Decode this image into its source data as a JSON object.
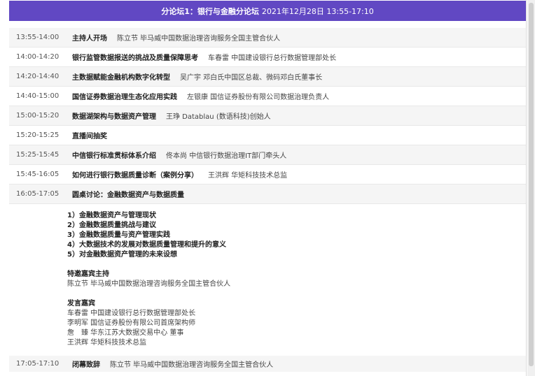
{
  "header": {
    "title": "分论坛1：银行与金融分论坛",
    "datetime": "2021年12月28日 13:55-17:10"
  },
  "schedule": [
    {
      "time": "13:55-14:00",
      "topic": "主持人开场",
      "speaker": "陈立节 毕马威中国数据治理咨询服务全国主管合伙人"
    },
    {
      "time": "14:00-14:20",
      "topic": "银行监管数据报送的挑战及质量保障思考",
      "speaker": "车春雷 中国建设银行总行数据管理部处长"
    },
    {
      "time": "14:20-14:40",
      "topic": "主数据赋能金融机构数字化转型",
      "speaker": "吴广宇 邓白氏中国区总裁、微码邓白氏董事长"
    },
    {
      "time": "14:40-15:00",
      "topic": "国信证券数据治理生态化应用实践",
      "speaker": "左银康 国信证券股份有限公司数据治理负责人"
    },
    {
      "time": "15:00-15:20",
      "topic": "数据湖架构与数据资产管理",
      "speaker": "王琤 Datablau (数语科技)创始人"
    },
    {
      "time": "15:20-15:25",
      "topic": "直播间抽奖",
      "speaker": ""
    },
    {
      "time": "15:25-15:45",
      "topic": "中信银行标准贯标体系介绍",
      "speaker": "佟本尚 中信银行数据治理IT部门牵头人"
    },
    {
      "time": "15:45-16:05",
      "topic": "如何进行银行数据质量诊断（案例分享）",
      "speaker": "王洪辉 华矩科技技术总监"
    },
    {
      "time": "16:05-17:05",
      "topic": "圆桌讨论：金融数据资产与数据质量",
      "speaker": ""
    }
  ],
  "panel": {
    "points": [
      "1）金融数据资产与管理现状",
      "2）金融数据质量挑战与建议",
      "3）金融数据质量与资产管理实践",
      "4）大数据技术的发展对数据质量管理和提升的意义",
      "5）对金融数据资产管理的未来设想"
    ],
    "host_title": "特邀嘉宾主持",
    "host": "陈立节 毕马威中国数据治理咨询服务全国主管合伙人",
    "guests_title": "发言嘉宾",
    "guests": [
      "车春雷 中国建设银行总行数据管理部处长",
      "李明军 国信证券股份有限公司首席架构师",
      "詹　臻 华东江苏大数据交易中心 董事",
      "王洪辉 华矩科技技术总监"
    ]
  },
  "closing": {
    "time": "17:05-17:10",
    "topic": "闭幕致辞",
    "speaker": "陈立节 毕马威中国数据治理咨询服务全国主管合伙人"
  },
  "colors": {
    "header_bg": "#6148c3",
    "row_alt_bg": "#f5f5f5"
  }
}
